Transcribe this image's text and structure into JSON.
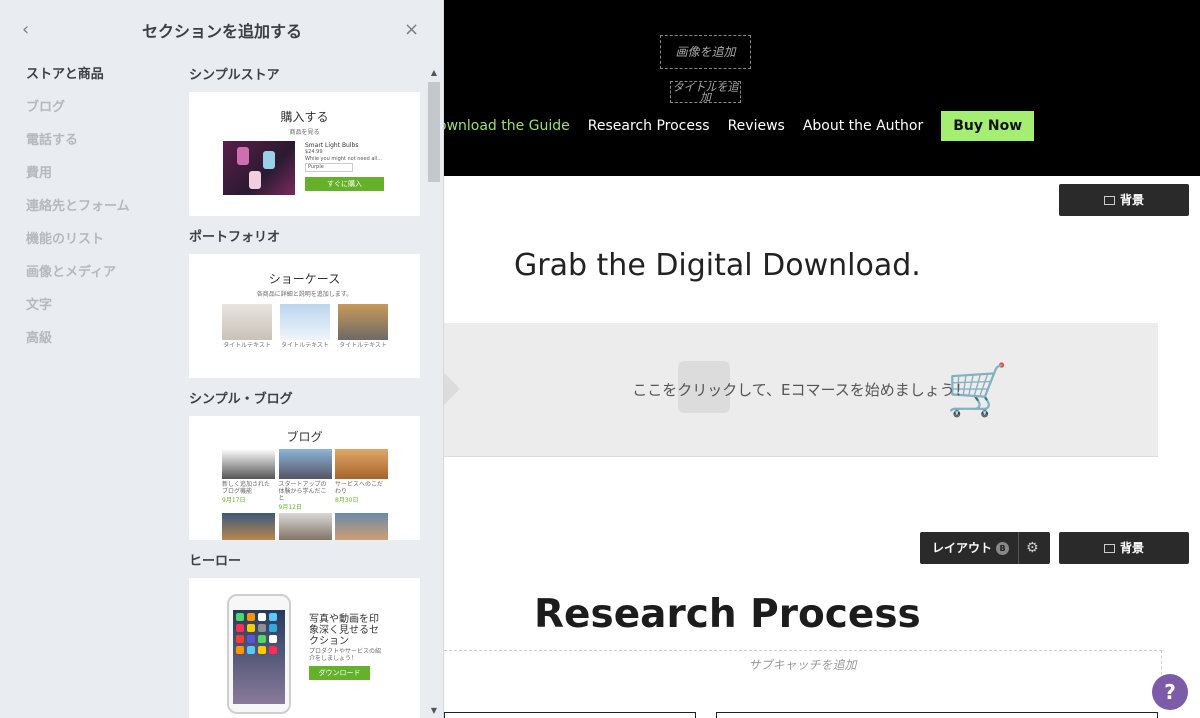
{
  "panel": {
    "title": "セクションを追加する",
    "back_icon": "‹",
    "close_icon": "×",
    "categories": [
      "ストアと商品",
      "ブログ",
      "電話する",
      "費用",
      "連絡先とフォーム",
      "機能のリスト",
      "画像とメディア",
      "文字",
      "高級"
    ],
    "sections": [
      {
        "label": "シンプルストア",
        "card_title": "購入する",
        "card_sub": "商品を見る",
        "product_name": "Smart Light Bulbs",
        "product_price": "$24.99",
        "product_desc": "While you might not need all...",
        "product_option": "Purple",
        "buy_label": "すぐに購入"
      },
      {
        "label": "ポートフォリオ",
        "card_title": "ショーケース",
        "card_sub": "各商品に詳細と説明を追加します。",
        "captions": [
          "タイトルテキスト",
          "タイトルテキスト",
          "タイトルテキスト"
        ]
      },
      {
        "label": "シンプル・ブログ",
        "card_title": "ブログ",
        "posts": [
          {
            "caption": "新しく追加されたブログ機能",
            "date": "9月17日"
          },
          {
            "caption": "スタートアップの体験から学んだこと",
            "date": "9月12日"
          },
          {
            "caption": "サービスへのこだわり",
            "date": "8月30日"
          }
        ]
      },
      {
        "label": "ヒーロー",
        "headline": "写真や動画を印象深く見せるセクション",
        "sub": "プロダクトやサービスの紹介をしましょう！",
        "button": "ダウンロード"
      }
    ],
    "scroll_up": "▲",
    "scroll_down": "▼"
  },
  "header": {
    "add_image": "画像を追加",
    "add_title": "タイトルを追加",
    "nav": [
      "ownload the Guide",
      "Research Process",
      "Reviews",
      "About the Author"
    ],
    "buy_now": "Buy Now"
  },
  "canvas": {
    "background_label": "背景",
    "grab_title": "Grab the Digital Download.",
    "ecom_text": "ここをクリックして、Eコマースを始めましょう！",
    "cart_icon": "🛒",
    "layout_label": "レイアウト",
    "layout_badge": "B",
    "gear_icon": "⚙",
    "research_title": "Research Process",
    "subcatch": "サブキャッチを追加",
    "help": "?"
  },
  "colors": {
    "accent_green": "#a4ef72",
    "button_green": "#65b12c",
    "help_purple": "#7c5ca9",
    "panel_bg": "#e9ecf0"
  }
}
